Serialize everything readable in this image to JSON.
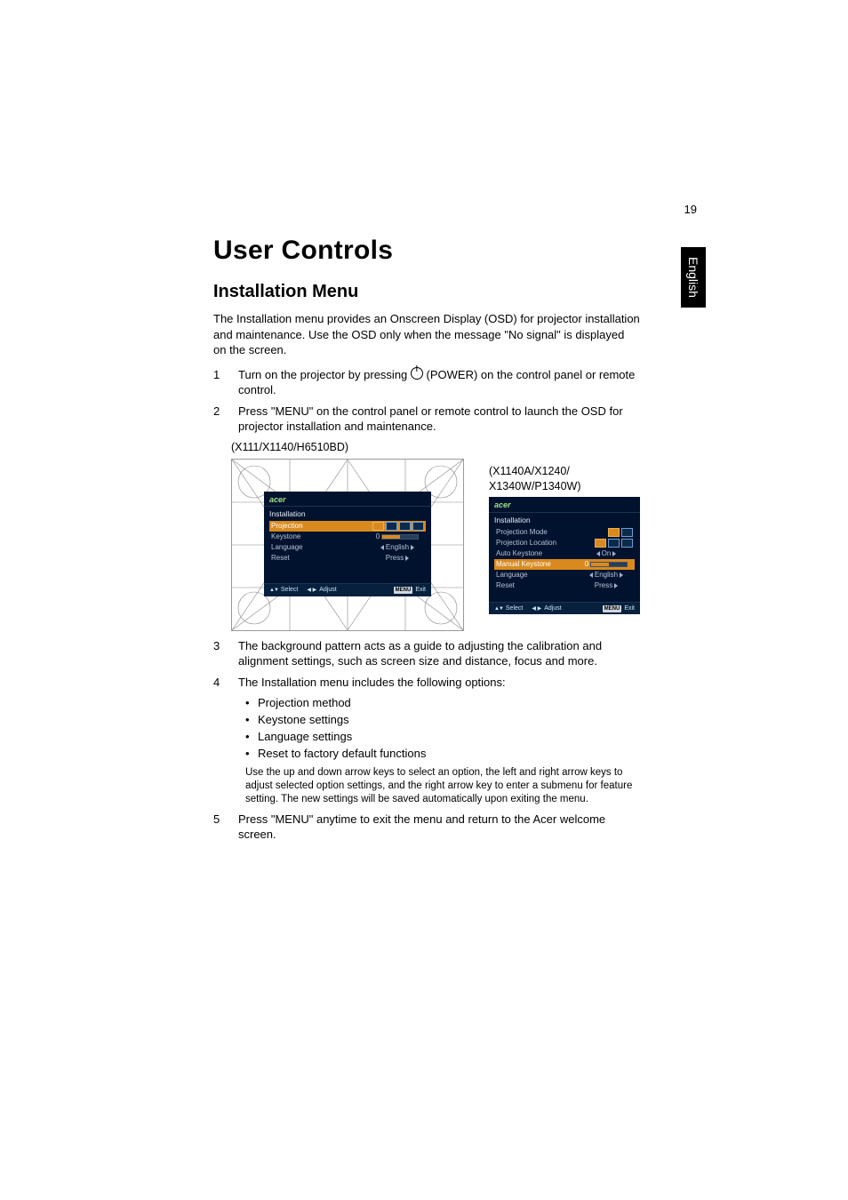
{
  "page_number": "19",
  "side_tab": "English",
  "heading": "User Controls",
  "subheading": "Installation Menu",
  "intro": "The Installation menu provides an Onscreen Display (OSD) for projector installation and maintenance. Use the OSD only when the message \"No signal\" is displayed on the screen.",
  "steps": {
    "s1_pre": "Turn on the projector by pressing ",
    "s1_post": " (POWER) on the control panel or remote control.",
    "s2": "Press \"MENU\" on the control panel or remote control to launch the OSD for projector installation and maintenance.",
    "s3": "The background pattern acts as a guide to adjusting the calibration and alignment settings, such as screen size and distance, focus and more.",
    "s4": "The Installation menu includes the following options:",
    "s5": "Press \"MENU\" anytime to exit the menu and return to the Acer welcome screen."
  },
  "fig_left_caption": "(X111/X1140/H6510BD)",
  "fig_right_caption": "(X1140A/X1240/\nX1340W/P1340W)",
  "osd": {
    "brand": "acer",
    "title": "Installation",
    "left": {
      "rows": [
        {
          "label": "Projection",
          "type": "icons4",
          "sel": true
        },
        {
          "label": "Keystone",
          "type": "slider",
          "num": "0"
        },
        {
          "label": "Language",
          "type": "lr",
          "val": "English"
        },
        {
          "label": "Reset",
          "type": "r",
          "val": "Press"
        }
      ]
    },
    "right": {
      "rows": [
        {
          "label": "Projection Mode",
          "type": "icons2"
        },
        {
          "label": "Projection Location",
          "type": "icons3"
        },
        {
          "label": "Auto Keystone",
          "type": "lr",
          "val": "On"
        },
        {
          "label": "Manual Keystone",
          "type": "slider",
          "num": "0",
          "sel": true
        },
        {
          "label": "Language",
          "type": "lr",
          "val": "English"
        },
        {
          "label": "Reset",
          "type": "r",
          "val": "Press"
        }
      ]
    },
    "footer": {
      "select": "Select",
      "adjust": "Adjust",
      "menu_key": "MENU",
      "exit": "Exit"
    }
  },
  "bullets": [
    "Projection method",
    "Keystone settings",
    "Language settings",
    "Reset to factory default functions"
  ],
  "note": "Use the up and down arrow keys to select an option, the left and right arrow keys to adjust selected option settings, and the right arrow key to enter a submenu for feature setting. The new settings will be saved automatically upon exiting the menu."
}
